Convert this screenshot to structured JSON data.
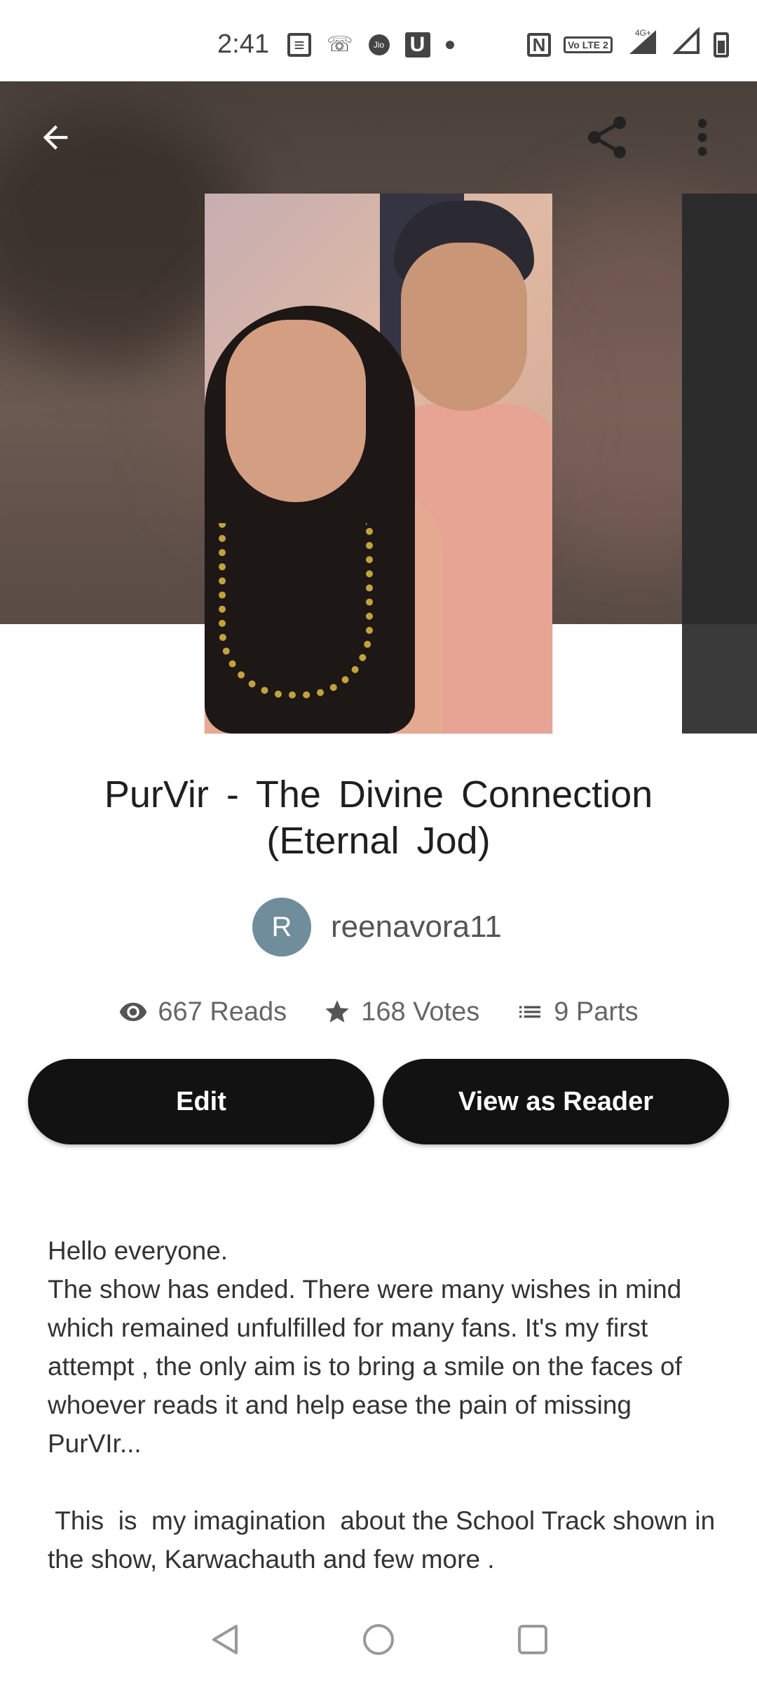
{
  "status_bar": {
    "time": "2:41",
    "network_label": "4G+",
    "volte_label": "Vo LTE 2",
    "jio_label": "Jio",
    "u_label": "U",
    "nfc_label": "N"
  },
  "header": {
    "back_icon": "arrow-left-icon",
    "share_icon": "share-icon",
    "more_icon": "more-vert-icon"
  },
  "story": {
    "title": "PurVir - The Divine Connection (Eternal Jod)",
    "author_initial": "R",
    "author_name": "reenavora11",
    "reads": "667 Reads",
    "votes": "168 Votes",
    "parts": "9 Parts"
  },
  "actions": {
    "edit_label": "Edit",
    "view_as_reader_label": "View as Reader"
  },
  "description": "Hello everyone.\nThe show has ended. There were many wishes in mind which remained unfulfilled for many fans. It's my first attempt , the only aim is to bring a smile on the faces of whoever reads it and help ease the pain of missing PurVIr...\n\n This  is  my imagination  about the School Track shown in the show, Karwachauth and few more .",
  "nav": {
    "back_icon": "nav-back-icon",
    "home_icon": "nav-home-icon",
    "recents_icon": "nav-recents-icon"
  },
  "colors": {
    "button_bg": "#121212",
    "avatar_bg": "#6f8d9b",
    "hero_bg": "#5a4d46"
  }
}
